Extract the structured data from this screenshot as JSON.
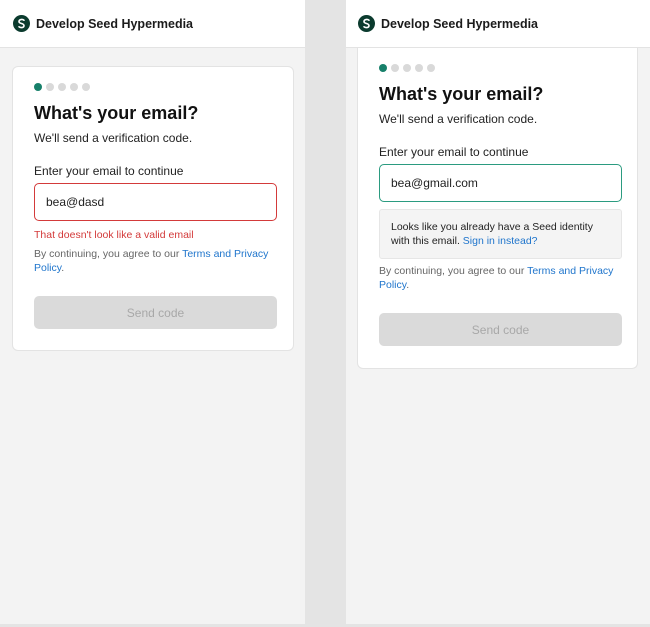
{
  "brand": {
    "name": "Develop Seed Hypermedia",
    "logo_icon": "seed-logo-icon",
    "logo_color": "#0b3b2e"
  },
  "colors": {
    "accent": "#17806a",
    "error": "#d33a3a",
    "link": "#1f75cc",
    "success_border": "#2b9b80"
  },
  "left": {
    "steps_total": 5,
    "active_step": 1,
    "title": "What's your email?",
    "subtitle": "We'll send a verification code.",
    "field_label": "Enter your email to continue",
    "email_value": "bea@dasd",
    "error_message": "That doesn't look like a valid email",
    "terms_prefix": "By continuing, you agree to our ",
    "terms_link": "Terms and Privacy Policy",
    "terms_suffix": ".",
    "send_label": "Send code"
  },
  "right": {
    "steps_total": 5,
    "active_step": 1,
    "title": "What's your email?",
    "subtitle": "We'll send a verification code.",
    "field_label": "Enter your email to continue",
    "email_value": "bea@gmail.com",
    "notice_text": "Looks like you already have a Seed identity with this email. ",
    "notice_link": "Sign in instead?",
    "terms_prefix": "By continuing, you agree to our ",
    "terms_link": "Terms and Privacy Policy",
    "terms_suffix": ".",
    "send_label": "Send code"
  }
}
